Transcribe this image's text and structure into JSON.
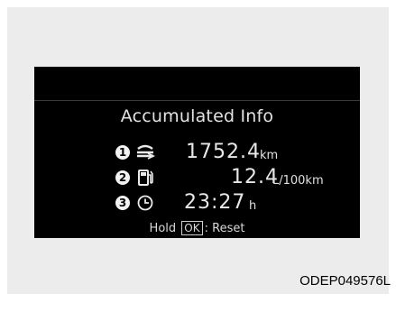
{
  "screen": {
    "title": "Accumulated Info",
    "rows": [
      {
        "badge": "1",
        "icon": "road-distance-icon",
        "value": "1752.4",
        "unit": "km"
      },
      {
        "badge": "2",
        "icon": "fuel-pump-icon",
        "value": "12.4",
        "unit": "L/100km"
      },
      {
        "badge": "3",
        "icon": "clock-icon",
        "value": "23:27",
        "unit": "h"
      }
    ],
    "hold_text": "Hold",
    "ok_label": "OK",
    "reset_text": ": Reset"
  },
  "caption": "ODEP049576L",
  "colors": {
    "screen_bg": "#000000",
    "outer_bg": "#ececec",
    "text": "#e2e2e2"
  }
}
